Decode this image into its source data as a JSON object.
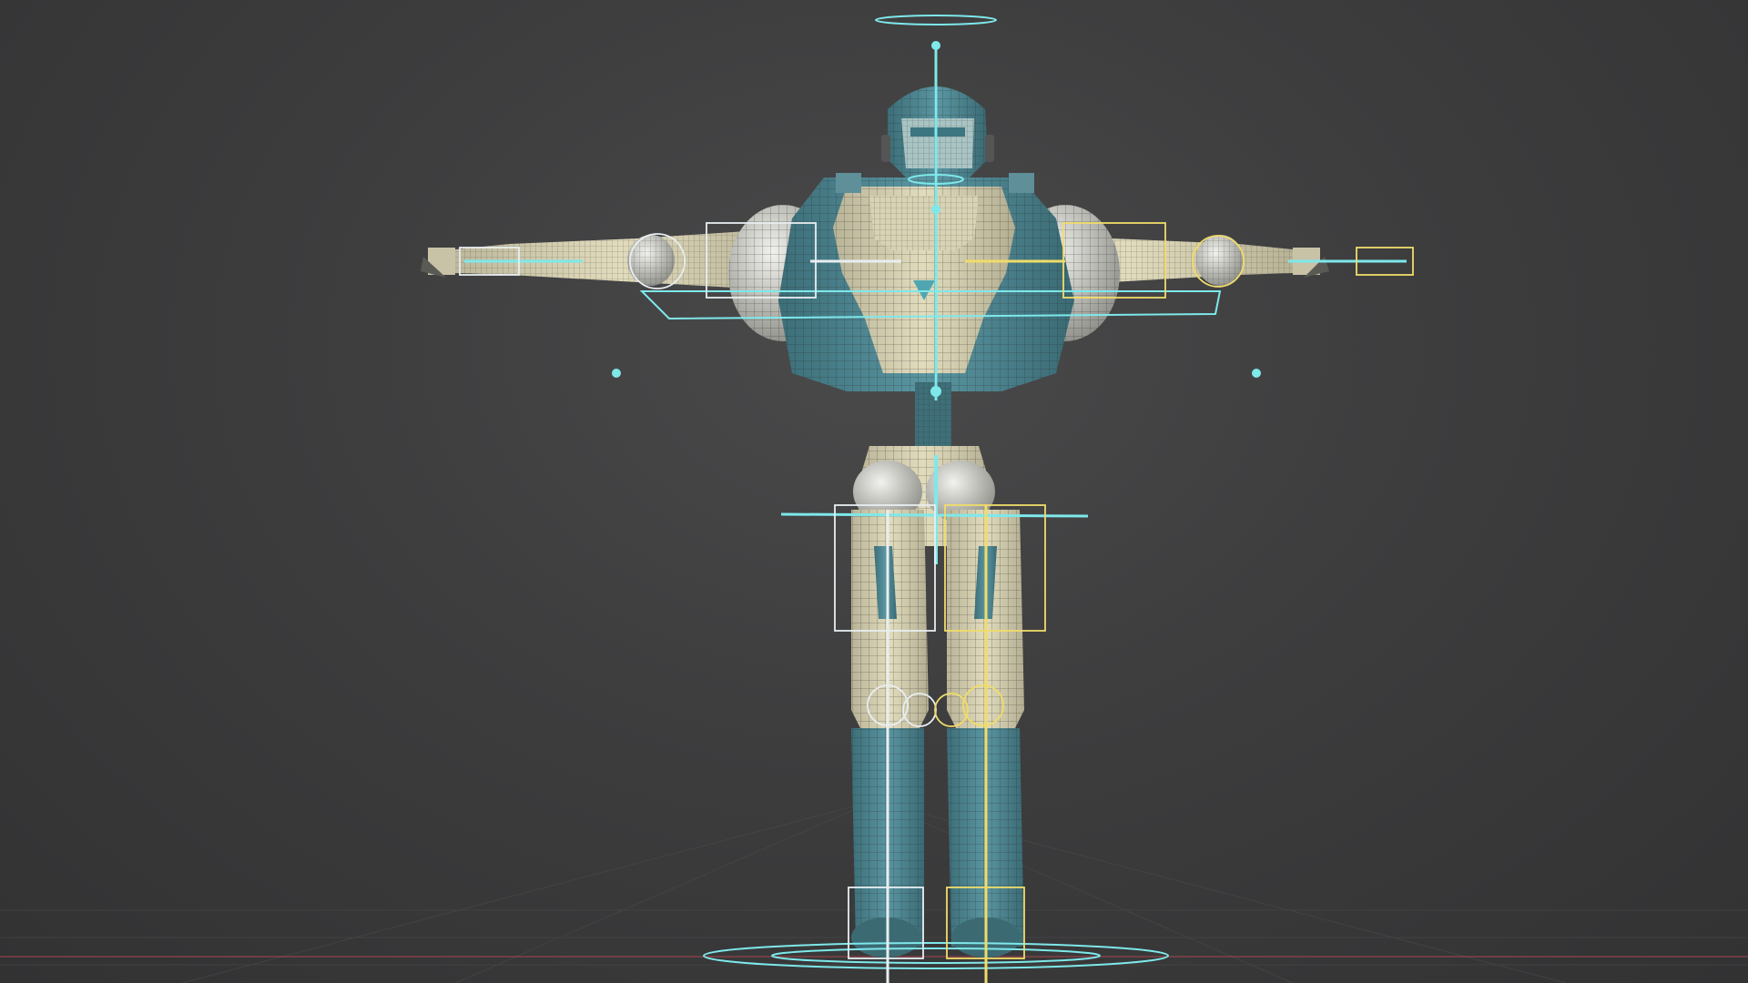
{
  "viewport": {
    "background": "#3d3d3e",
    "grid_color": "#4a4a4b",
    "x_axis_color": "#b84a52"
  },
  "robot": {
    "armor_color": "#d8d2b4",
    "underlay_color": "#4f8a96",
    "wire_color": "#2b2b28"
  },
  "rig": {
    "control_cyan": "#7ee8ea",
    "control_white": "#e8eef0",
    "control_yellow": "#f0dc6a"
  }
}
